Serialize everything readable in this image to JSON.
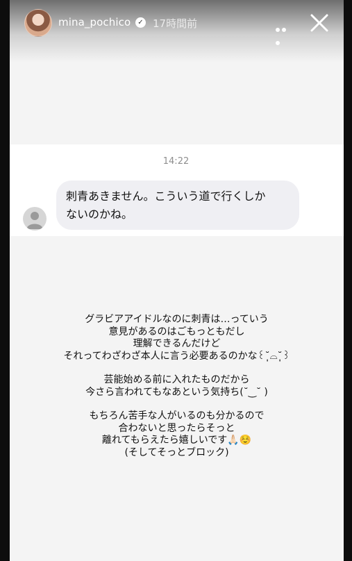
{
  "header": {
    "username": "mina_pochico",
    "time_ago": "17時間前",
    "verified_icon": "verified-badge",
    "more_icon": "more-dots",
    "close_icon": "close-x"
  },
  "dm": {
    "timestamp": "14:22",
    "message_lines": [
      "刺青あきません。こういう道で行くしか",
      "ないのかね。"
    ]
  },
  "body": {
    "paragraphs": [
      [
        "グラビアアイドルなのに刺青は…っていう",
        "意見があるのはごもっともだし",
        "理解できるんだけど",
        "それってわざわざ本人に言う必要あるのかな꒰˘̩̩̩⌓˘̩̩̩꒱"
      ],
      [
        "芸能始める前に入れたものだから",
        "今さら言われてもなあという気持ち(˘‿˘ )"
      ],
      [
        "もちろん苦手な人がいるのも分かるので",
        "合わないと思ったらそっと",
        "離れてもらえたら嬉しいです🙏🏻☺️",
        "(そしてそっとブロック)"
      ]
    ]
  }
}
